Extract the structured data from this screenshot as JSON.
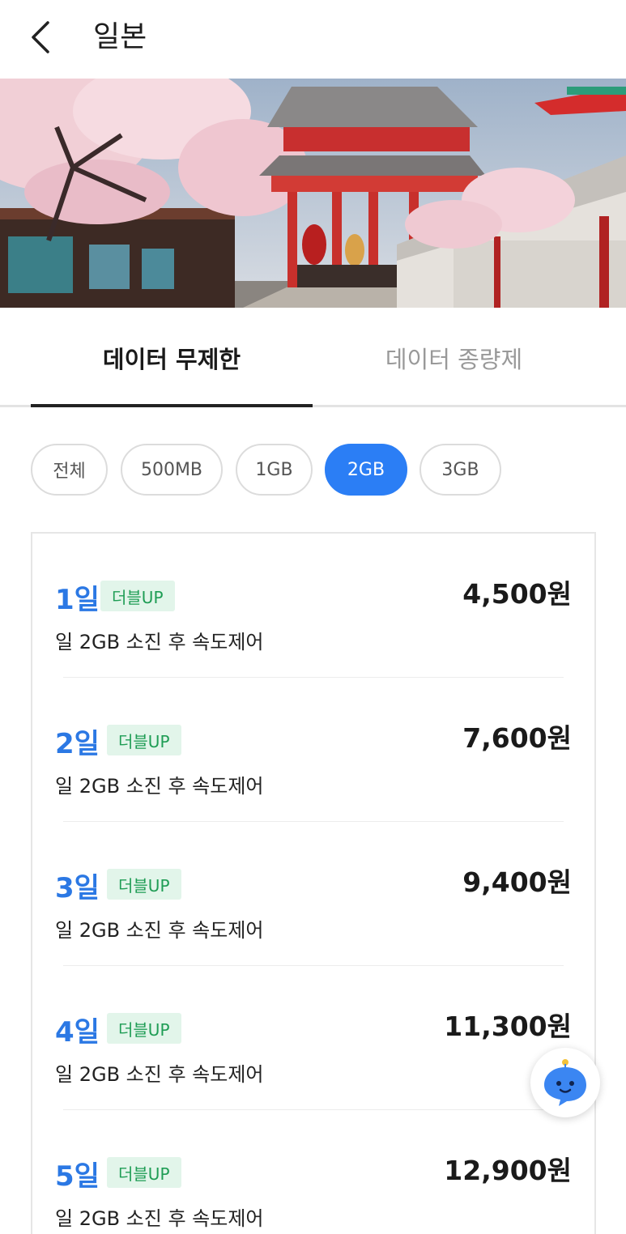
{
  "header": {
    "title": "일본"
  },
  "tabs": [
    {
      "label": "데이터 무제한",
      "active": true
    },
    {
      "label": "데이터 종량제",
      "active": false
    }
  ],
  "filters": [
    {
      "label": "전체",
      "active": false
    },
    {
      "label": "500MB",
      "active": false
    },
    {
      "label": "1GB",
      "active": false
    },
    {
      "label": "2GB",
      "active": true
    },
    {
      "label": "3GB",
      "active": false
    }
  ],
  "plans": [
    {
      "days": "1일",
      "badge": "더블UP",
      "price": "4,500원",
      "desc": "일 2GB 소진 후 속도제어"
    },
    {
      "days": "2일",
      "badge": "더블UP",
      "price": "7,600원",
      "desc": "일 2GB 소진 후 속도제어"
    },
    {
      "days": "3일",
      "badge": "더블UP",
      "price": "9,400원",
      "desc": "일 2GB 소진 후 속도제어"
    },
    {
      "days": "4일",
      "badge": "더블UP",
      "price": "11,300원",
      "desc": "일 2GB 소진 후 속도제어"
    },
    {
      "days": "5일",
      "badge": "더블UP",
      "price": "12,900원",
      "desc": "일 2GB 소진 후 속도제어"
    }
  ],
  "colors": {
    "accent": "#2b7ef5",
    "days": "#2b78e4",
    "badge_bg": "#e2f5ea",
    "badge_text": "#1f9d55"
  },
  "icons": {
    "back": "chevron-left-icon",
    "chatbot": "chatbot-icon"
  }
}
